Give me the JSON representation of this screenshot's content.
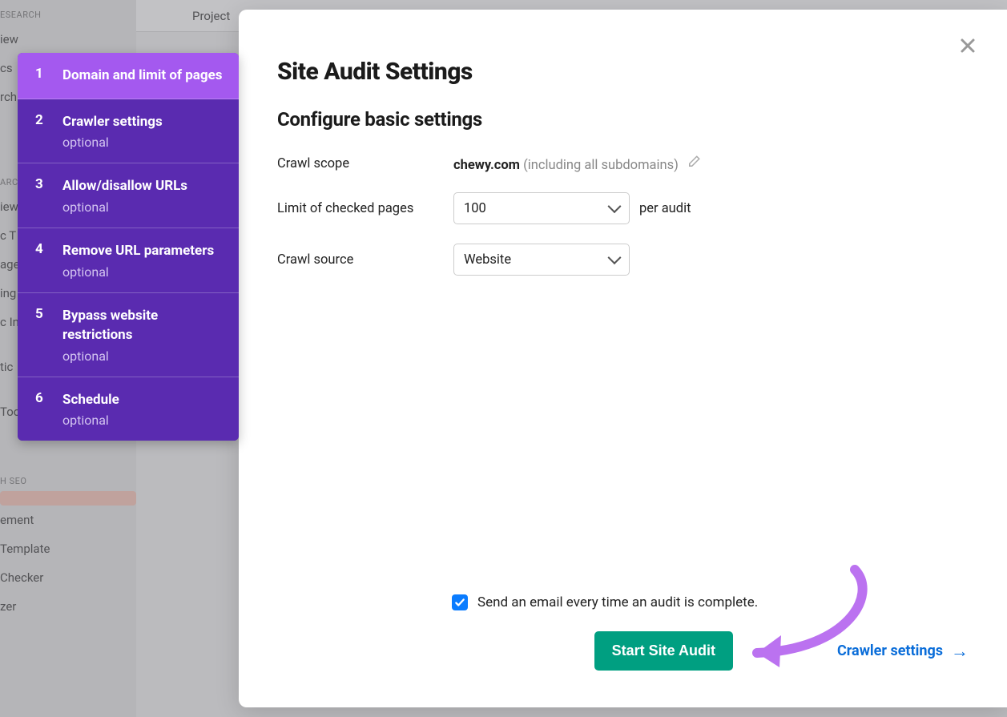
{
  "background": {
    "section1_label": "ESEARCH",
    "items1": [
      "iew",
      "cs",
      "rch"
    ],
    "section2_label": "ARC",
    "items2": [
      "iew",
      "c T",
      "age",
      "ing",
      "c In",
      "tic",
      "Tool"
    ],
    "section3_label": "H SEO",
    "highlight_item": "",
    "items3": [
      "ement",
      "Template",
      "Checker",
      "zer"
    ],
    "topbar_label": "Project"
  },
  "stepper": [
    {
      "num": "1",
      "title": "Domain and limit of pages",
      "optional": ""
    },
    {
      "num": "2",
      "title": "Crawler settings",
      "optional": "optional"
    },
    {
      "num": "3",
      "title": "Allow/disallow URLs",
      "optional": "optional"
    },
    {
      "num": "4",
      "title": "Remove URL parameters",
      "optional": "optional"
    },
    {
      "num": "5",
      "title": "Bypass website restrictions",
      "optional": "optional"
    },
    {
      "num": "6",
      "title": "Schedule",
      "optional": "optional"
    }
  ],
  "modal": {
    "title": "Site Audit Settings",
    "subtitle": "Configure basic settings",
    "crawl_scope_label": "Crawl scope",
    "crawl_scope_domain": "chewy.com",
    "crawl_scope_note": "(including all subdomains)",
    "limit_label": "Limit of checked pages",
    "limit_value": "100",
    "limit_suffix": "per audit",
    "source_label": "Crawl source",
    "source_value": "Website",
    "email_label": "Send an email every time an audit is complete.",
    "start_button": "Start Site Audit",
    "next_link": "Crawler settings"
  }
}
